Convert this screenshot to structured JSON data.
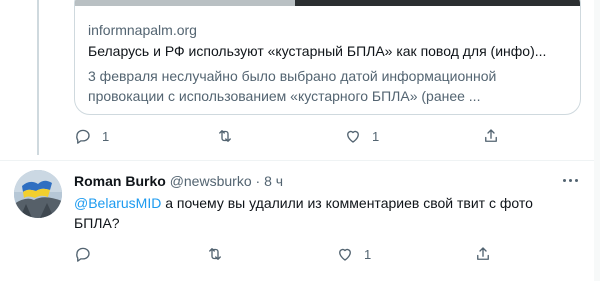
{
  "card": {
    "domain": "informnapalm.org",
    "title": "Беларусь и РФ используют «кустарный БПЛА» как повод для (инфо)...",
    "description_line1": "3 февраля неслучайно было выбрано датой информационной",
    "description_line2": "провокации с использованием «кустарного БПЛА» (ранее ..."
  },
  "first_actions": {
    "reply_count": "1",
    "retweet_count": "",
    "like_count": "1",
    "reply_icon": "reply-icon",
    "retweet_icon": "retweet-icon",
    "like_icon": "heart-icon",
    "share_icon": "share-icon"
  },
  "reply": {
    "name": "Roman Burko",
    "handle": "@newsburko",
    "dot": "·",
    "time": "8 ч",
    "mention": "@BelarusMID",
    "text": " а почему вы удалили из комментариев свой твит с фото БПЛА?"
  },
  "second_actions": {
    "reply_count": "",
    "retweet_count": "",
    "like_count": "1"
  },
  "colors": {
    "link": "#1d9bf0",
    "secondary_text": "#536471",
    "border": "#cfd9de"
  }
}
